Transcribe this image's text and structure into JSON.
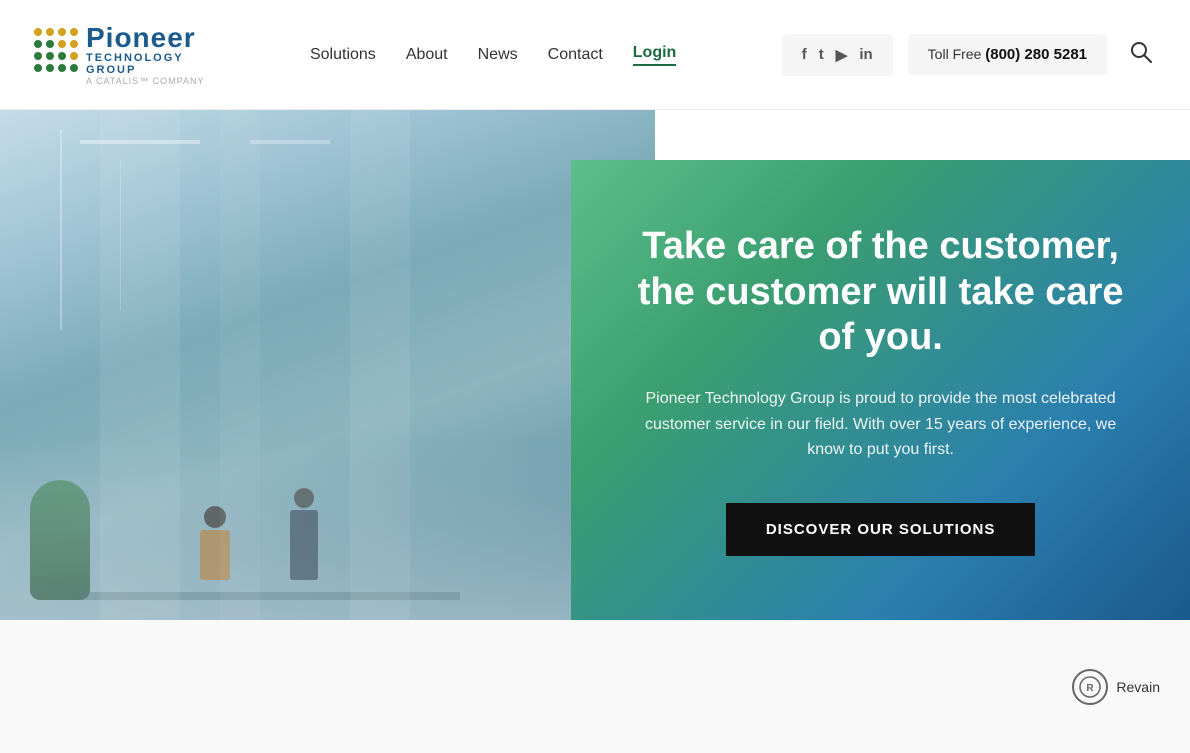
{
  "header": {
    "logo": {
      "brand": "Pioneer",
      "line1": "TECHNOLOGY",
      "line2": "GROUP",
      "catalis": "A CATALIS™ COMPANY"
    },
    "nav": {
      "solutions": "Solutions",
      "about": "About",
      "news": "News",
      "contact": "Contact",
      "login": "Login"
    },
    "social": {
      "facebook": "f",
      "twitter": "t",
      "youtube": "▶",
      "linkedin": "in"
    },
    "phone": {
      "label": "Toll Free",
      "number": "(800) 280 5281"
    },
    "search_icon": "🔍"
  },
  "hero": {
    "headline": "Take care of the customer, the customer will take care of you.",
    "subtext": "Pioneer Technology Group is proud to provide the most celebrated customer service in our field. With over 15 years of experience, we know to put you first.",
    "cta_label": "DISCOVER OUR SOLUTIONS"
  },
  "footer": {
    "revain_label": "Revain"
  }
}
